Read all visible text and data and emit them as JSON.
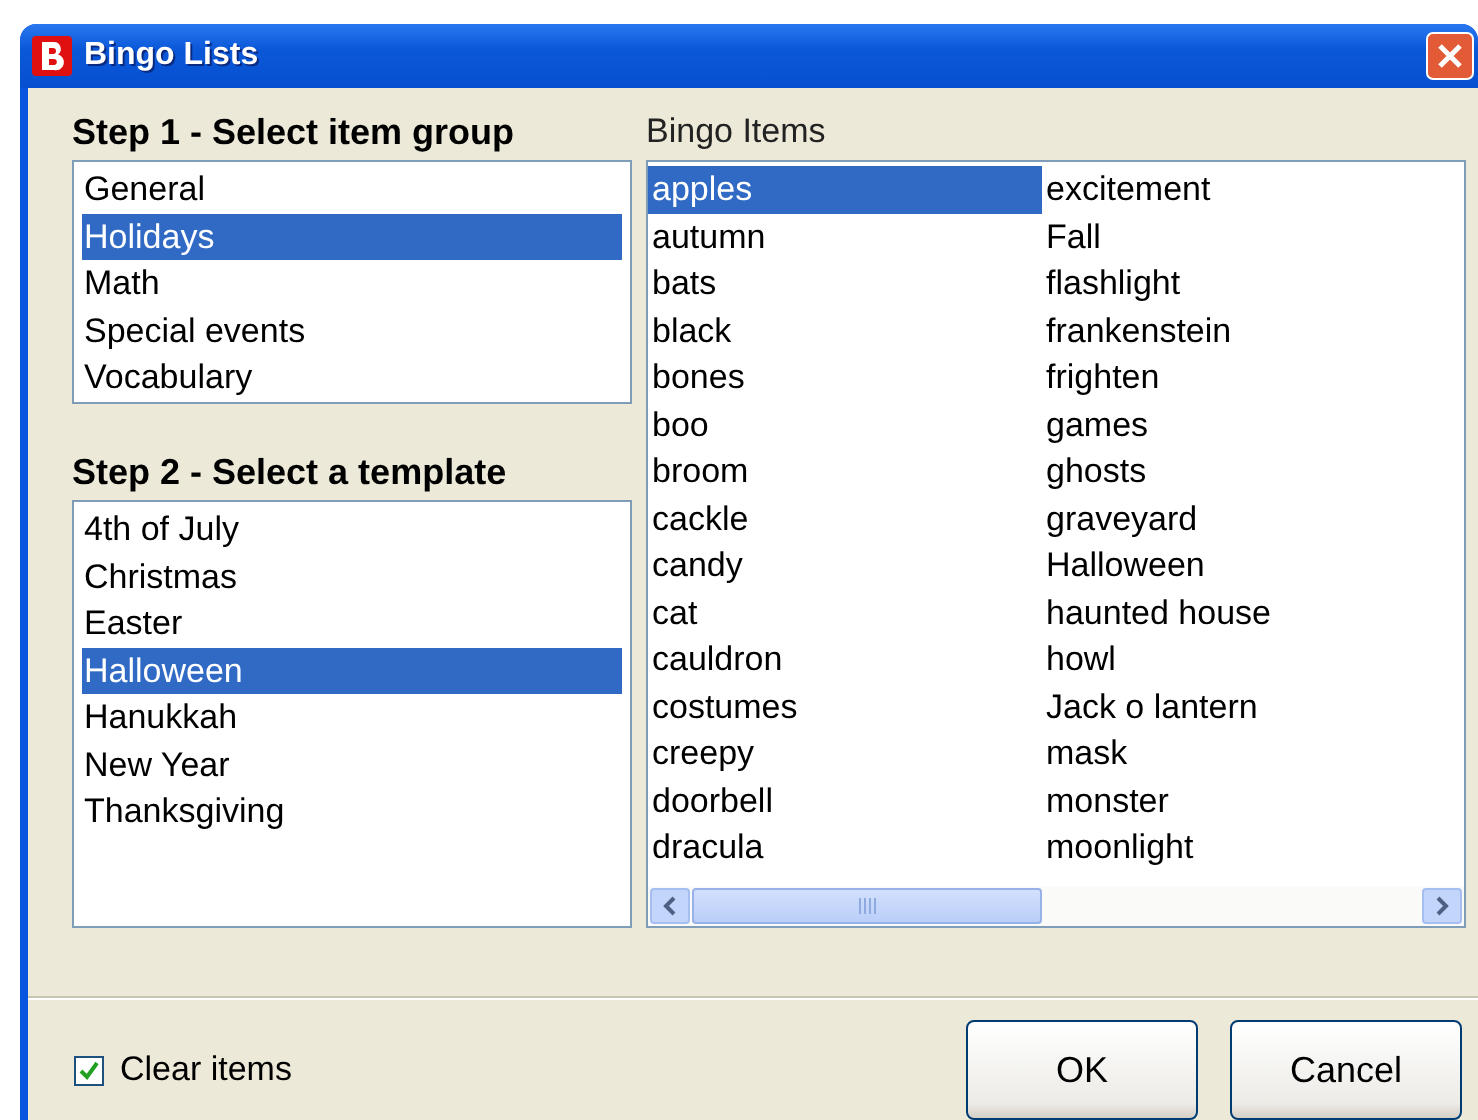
{
  "window": {
    "title": "Bingo Lists"
  },
  "step1": {
    "label": "Step 1 - Select item group",
    "items": [
      {
        "label": "General",
        "selected": false
      },
      {
        "label": "Holidays",
        "selected": true
      },
      {
        "label": "Math",
        "selected": false
      },
      {
        "label": "Special events",
        "selected": false
      },
      {
        "label": "Vocabulary",
        "selected": false
      }
    ]
  },
  "step2": {
    "label": "Step 2 - Select a template",
    "items": [
      {
        "label": "4th of July",
        "selected": false
      },
      {
        "label": "Christmas",
        "selected": false
      },
      {
        "label": "Easter",
        "selected": false
      },
      {
        "label": "Halloween",
        "selected": true
      },
      {
        "label": "Hanukkah",
        "selected": false
      },
      {
        "label": "New Year",
        "selected": false
      },
      {
        "label": "Thanksgiving",
        "selected": false
      }
    ]
  },
  "bingo_items": {
    "label": "Bingo Items",
    "columns": [
      [
        {
          "label": "apples",
          "selected": true
        },
        {
          "label": "autumn",
          "selected": false
        },
        {
          "label": "bats",
          "selected": false
        },
        {
          "label": "black",
          "selected": false
        },
        {
          "label": "bones",
          "selected": false
        },
        {
          "label": "boo",
          "selected": false
        },
        {
          "label": "broom",
          "selected": false
        },
        {
          "label": "cackle",
          "selected": false
        },
        {
          "label": "candy",
          "selected": false
        },
        {
          "label": "cat",
          "selected": false
        },
        {
          "label": "cauldron",
          "selected": false
        },
        {
          "label": "costumes",
          "selected": false
        },
        {
          "label": "creepy",
          "selected": false
        },
        {
          "label": "doorbell",
          "selected": false
        },
        {
          "label": "dracula",
          "selected": false
        }
      ],
      [
        {
          "label": "excitement",
          "selected": false
        },
        {
          "label": "Fall",
          "selected": false
        },
        {
          "label": "flashlight",
          "selected": false
        },
        {
          "label": "frankenstein",
          "selected": false
        },
        {
          "label": "frighten",
          "selected": false
        },
        {
          "label": "games",
          "selected": false
        },
        {
          "label": "ghosts",
          "selected": false
        },
        {
          "label": "graveyard",
          "selected": false
        },
        {
          "label": "Halloween",
          "selected": false
        },
        {
          "label": "haunted house",
          "selected": false
        },
        {
          "label": "howl",
          "selected": false
        },
        {
          "label": "Jack o lantern",
          "selected": false
        },
        {
          "label": "mask",
          "selected": false
        },
        {
          "label": "monster",
          "selected": false
        },
        {
          "label": "moonlight",
          "selected": false
        }
      ]
    ]
  },
  "clear_items": {
    "label": "Clear items",
    "checked": true
  },
  "buttons": [
    "OK",
    "Cancel"
  ]
}
